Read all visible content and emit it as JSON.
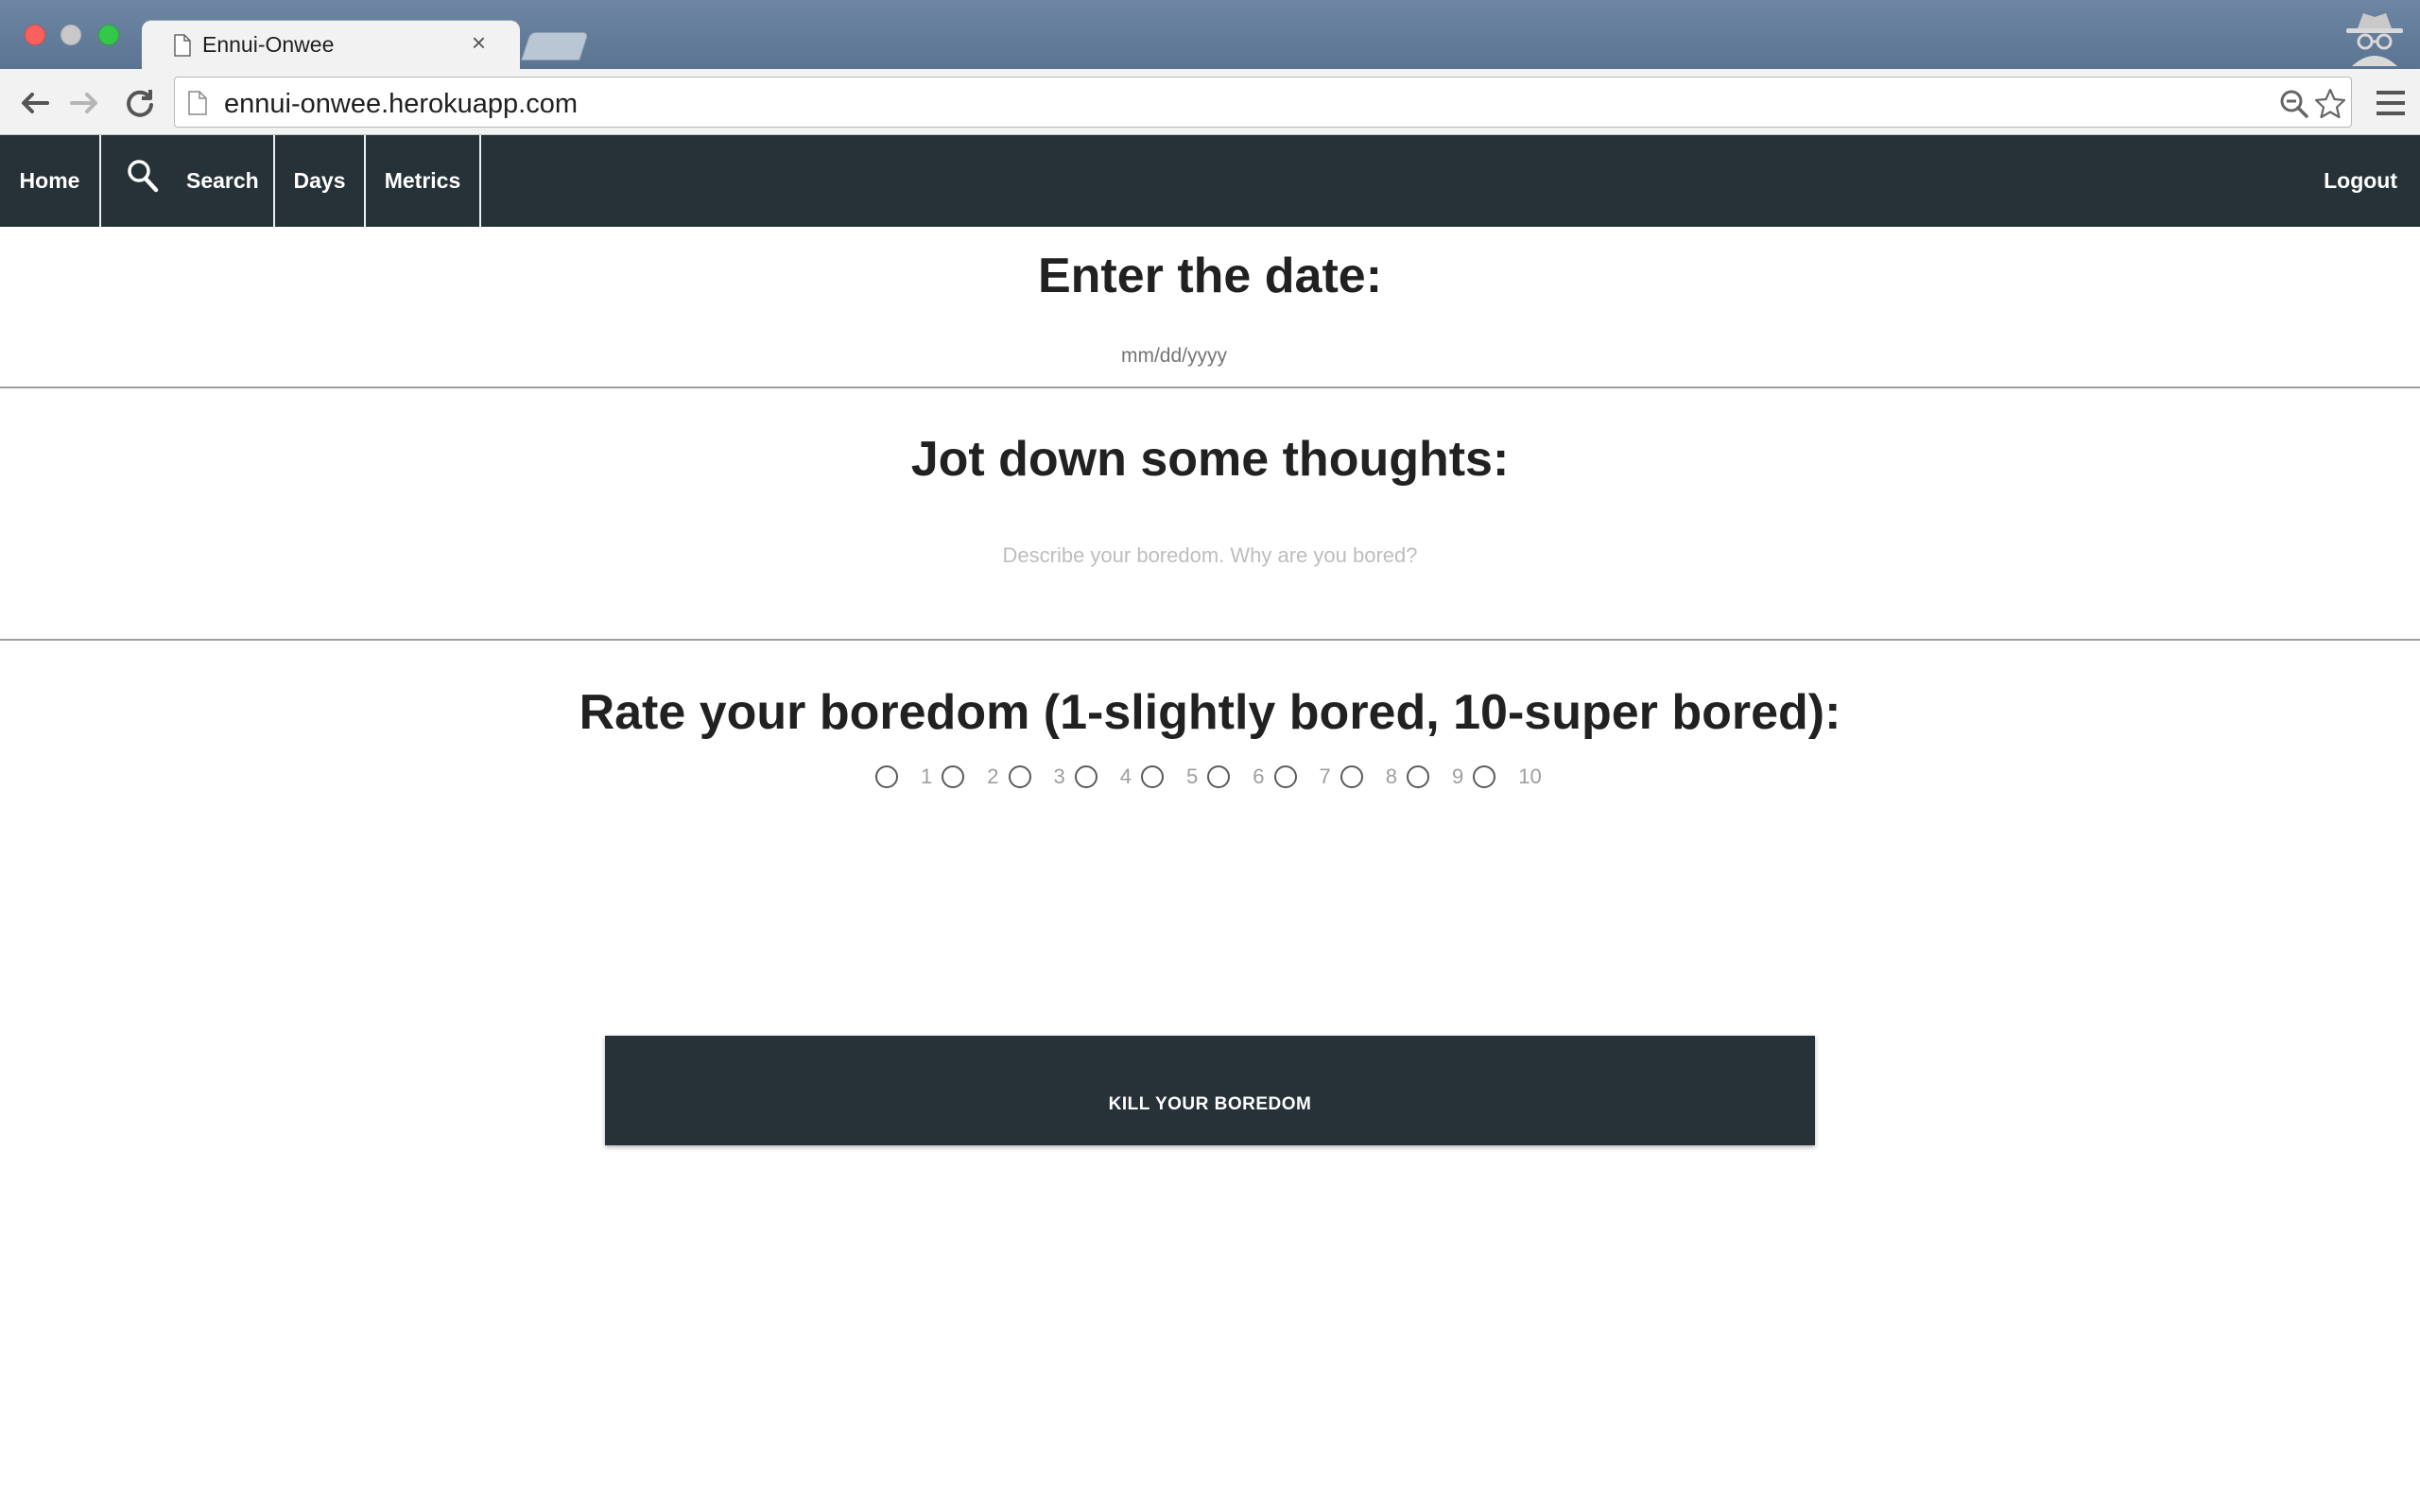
{
  "browser": {
    "tab_title": "Ennui-Onwee",
    "tab_close": "×",
    "url": "ennui-onwee.herokuapp.com"
  },
  "navbar": {
    "items": [
      {
        "label": "Home"
      },
      {
        "label": "Search",
        "icon": "search-icon"
      },
      {
        "label": "Days"
      },
      {
        "label": "Metrics"
      }
    ],
    "logout_label": "Logout",
    "bg_color": "#263238"
  },
  "date_section": {
    "heading": "Enter the date:",
    "placeholder": "mm/dd/yyyy"
  },
  "thoughts_section": {
    "heading": "Jot down some thoughts:",
    "placeholder": "Describe your boredom. Why are you bored?"
  },
  "rating_section": {
    "heading": "Rate your boredom (1-slightly bored, 10-super bored):",
    "options": [
      "1",
      "2",
      "3",
      "4",
      "5",
      "6",
      "7",
      "8",
      "9",
      "10"
    ],
    "selected": null
  },
  "submit": {
    "label": "KILL YOUR BOREDOM",
    "color": "#263238"
  }
}
